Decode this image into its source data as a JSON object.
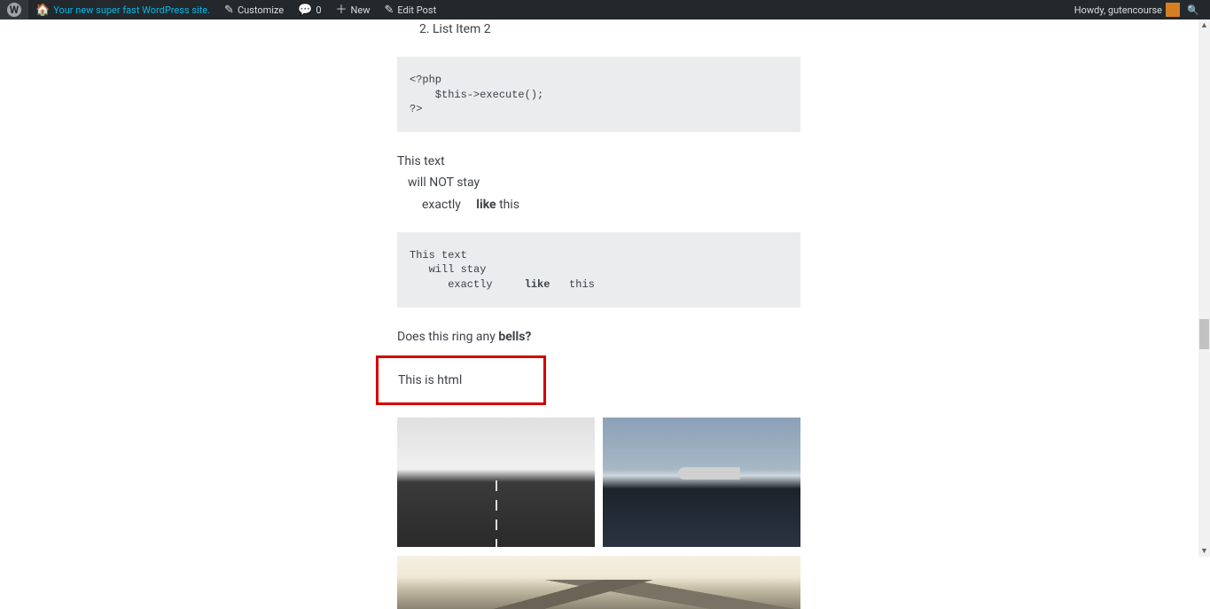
{
  "adminBar": {
    "siteName": "Your new super fast WordPress site.",
    "customize": "Customize",
    "commentsCount": "0",
    "newLabel": "New",
    "editPost": "Edit Post",
    "howdy": "Howdy, gutencourse"
  },
  "content": {
    "list": {
      "start": 2,
      "items": [
        "List Item 2"
      ]
    },
    "codeBlock1": "<?php\n    $this->execute();\n?>",
    "textBlock": {
      "line1": "This text",
      "line2": "will NOT stay",
      "line3a": "exactly",
      "line3b": "like",
      "line3c": " this"
    },
    "codeBlock2": "This text\n   will stay\n      exactly     like   this",
    "codeBlock2_parts": {
      "pre": "This text\n   will stay\n      exactly     ",
      "bold": "like",
      "post": "   this"
    },
    "doesThis": {
      "text": "Does this ring any ",
      "bold": "bells?"
    },
    "htmlBox": "This is html"
  }
}
